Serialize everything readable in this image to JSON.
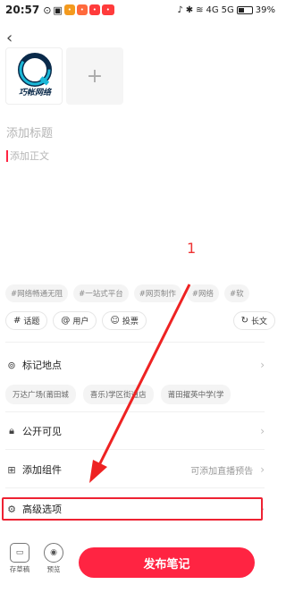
{
  "status_bar": {
    "time": "20:57",
    "network": "4G",
    "network2": "5G",
    "battery": "39%"
  },
  "editor": {
    "title_placeholder": "添加标题",
    "body_placeholder": "添加正文",
    "logo_text": "巧帐网络",
    "add_image_icon": "plus-icon"
  },
  "annotation": {
    "number": "1"
  },
  "topic_tags": [
    "#网络畅通无阻",
    "#一站式平台",
    "#网页制作",
    "#网络",
    "#软"
  ],
  "tools": [
    {
      "icon": "#",
      "label": "话题"
    },
    {
      "icon": "@",
      "label": "用户"
    },
    {
      "icon": "☺",
      "label": "投票"
    }
  ],
  "long_text_label": "长文",
  "location": {
    "label": "标记地点",
    "chips": [
      "万达广场(莆田城",
      "喜乐)学区街道店",
      "莆田擢英中学(学"
    ]
  },
  "visibility": {
    "label": "公开可见"
  },
  "component": {
    "label": "添加组件",
    "extra": "可添加直播预告"
  },
  "advanced": {
    "label": "高级选项"
  },
  "bottom": {
    "draft_label": "存草稿",
    "preview_label": "预览",
    "publish_label": "发布笔记"
  },
  "colors": {
    "accent": "#ff2442",
    "annotation": "#e22222"
  }
}
